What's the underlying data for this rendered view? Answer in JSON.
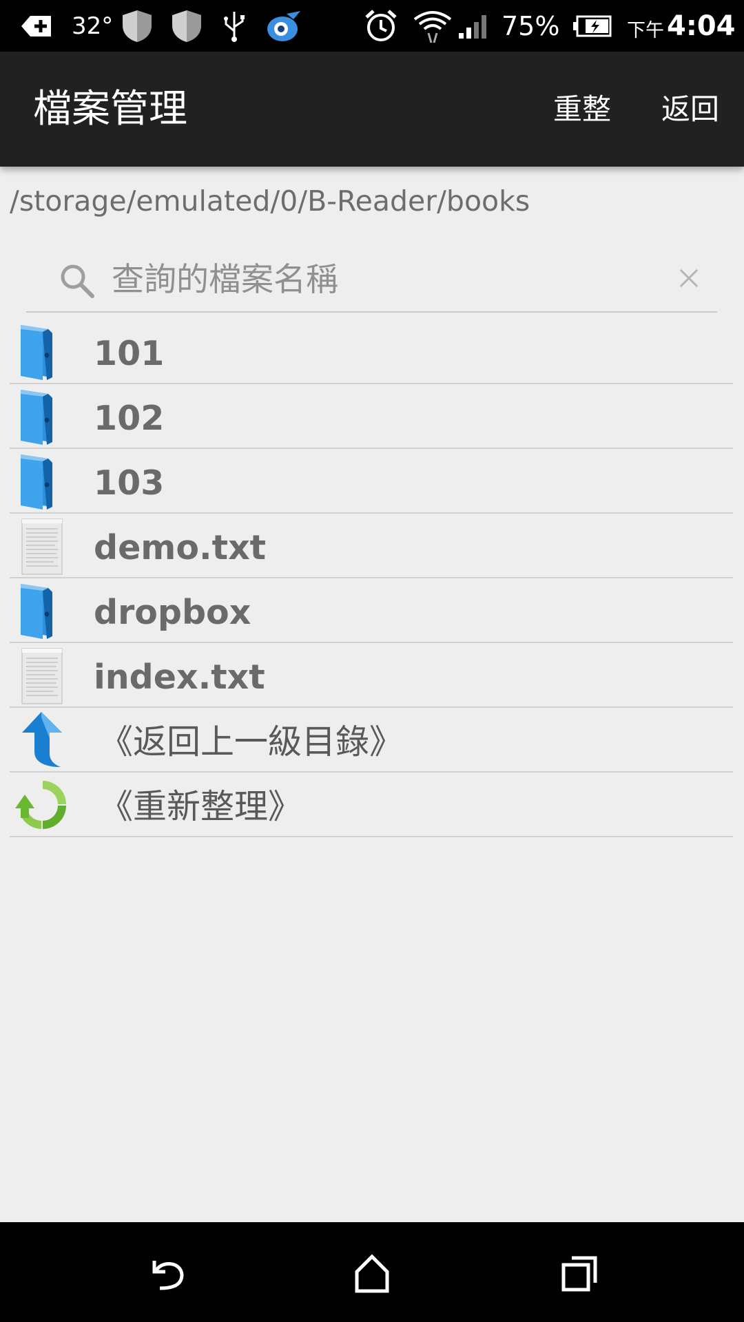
{
  "status_bar": {
    "temperature": "32°",
    "battery_percent": "75%",
    "time_ampm": "下午",
    "time": "4:04",
    "icons": [
      "add-notification-icon",
      "shield-icon",
      "shield-icon",
      "usb-icon",
      "app-bird-icon",
      "alarm-icon",
      "wifi-icon",
      "signal-icon",
      "battery-charging-icon"
    ]
  },
  "action_bar": {
    "title": "檔案管理",
    "refresh_label": "重整",
    "back_label": "返回"
  },
  "path": "/storage/emulated/0/B-Reader/books",
  "search": {
    "placeholder": "查詢的檔案名稱",
    "value": ""
  },
  "files": [
    {
      "name": "101",
      "type": "folder"
    },
    {
      "name": "102",
      "type": "folder"
    },
    {
      "name": "103",
      "type": "folder"
    },
    {
      "name": "demo.txt",
      "type": "file"
    },
    {
      "name": "dropbox",
      "type": "folder"
    },
    {
      "name": "index.txt",
      "type": "file"
    }
  ],
  "commands": {
    "up_directory": "《返回上一級目錄》",
    "refresh": "《重新整理》"
  },
  "colors": {
    "action_bar": "#212121",
    "background": "#eeeeee",
    "folder_blue": "#2f8fdc",
    "arrow_blue": "#1a7fd0",
    "refresh_green": "#7cc242"
  }
}
